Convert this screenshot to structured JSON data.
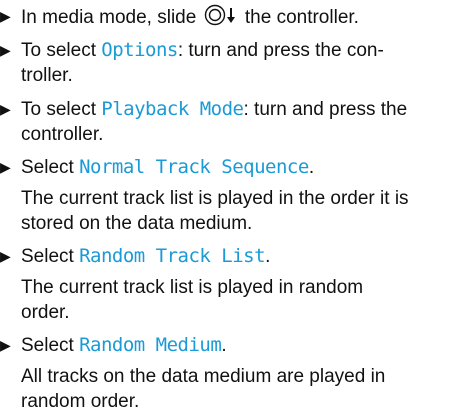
{
  "steps": [
    {
      "pre": "In media mode, slide ",
      "icon": "controller-slide-down-icon",
      "post": " the controller."
    },
    {
      "pre": "To select ",
      "menu": "Options",
      "post": ": turn and press the con-",
      "line2": "troller."
    },
    {
      "pre": "To select ",
      "menu": "Playback Mode",
      "post": ": turn and press the",
      "line2": "controller."
    },
    {
      "pre": "Select ",
      "menu": "Normal Track Sequence",
      "post": ".",
      "result_line1": "The current track list is played in the order it is",
      "result_line2": "stored on the data medium."
    },
    {
      "pre": "Select ",
      "menu": "Random Track List",
      "post": ".",
      "result_line1": "The current track list is played in random",
      "result_line2": "order."
    },
    {
      "pre": "Select ",
      "menu": "Random Medium",
      "post": ".",
      "result_line1": "All tracks on the data medium are played in",
      "result_line2": "random order."
    }
  ],
  "colors": {
    "menu_text": "#1a9ad6",
    "body_text": "#111111"
  }
}
